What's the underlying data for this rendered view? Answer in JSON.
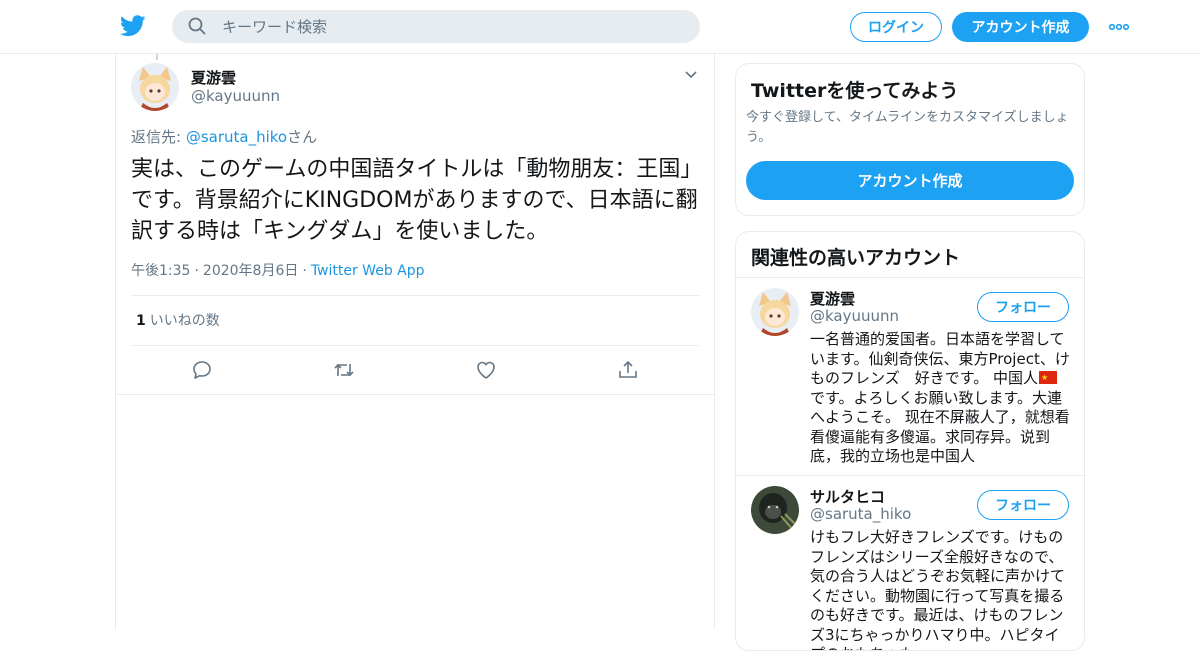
{
  "header": {
    "search_placeholder": "キーワード検索",
    "login_label": "ログイン",
    "signup_label": "アカウント作成",
    "brand_color": "#1da1f2"
  },
  "tweet": {
    "author_name": "夏游雲",
    "author_handle": "@kayuuunn",
    "reply_prefix": "返信先: ",
    "reply_to": "@saruta_hiko",
    "reply_suffix": "さん",
    "text": "実は、このゲームの中国語タイトルは「動物朋友：王国」です。背景紹介にKINGDOMがありますので、日本語に翻訳する時は「キングダム」を使いました。",
    "time": "午後1:35",
    "date": "2020年8月6日",
    "source": "Twitter Web App",
    "like_count": "1",
    "like_label": "いいねの数",
    "actions": [
      "reply-icon",
      "retweet-icon",
      "like-icon",
      "share-icon"
    ]
  },
  "signup_card": {
    "title": "Twitterを使ってみよう",
    "description": "今すぐ登録して、タイムラインをカスタマイズしましょう。",
    "button": "アカウント作成"
  },
  "related": {
    "title": "関連性の高いアカウント",
    "accounts": [
      {
        "name": "夏游雲",
        "handle": "@kayuuunn",
        "follow": "フォロー",
        "bio_a": "一名普通的爱国者。日本語を学習しています。仙剣奇侠伝、東方Project、けものフレンズ　好きです。 中国人",
        "bio_b": "です。よろしくお願い致します。大連へようこそ。 现在不屏蔽人了，就想看看傻逼能有多傻逼。求同存异。说到底，我的立场也是中国人"
      },
      {
        "name": "サルタヒコ",
        "handle": "@saruta_hiko",
        "follow": "フォロー",
        "bio": "けもフレ大好きフレンズです。けものフレンズはシリーズ全般好きなので、気の合う人はどうぞお気軽に声かけてください。動物園に行って写真を撮るのも好きです。最近は、けものフレンズ3にちゃっかりハマり中。ハピタイプのおもちゃも"
      }
    ]
  }
}
